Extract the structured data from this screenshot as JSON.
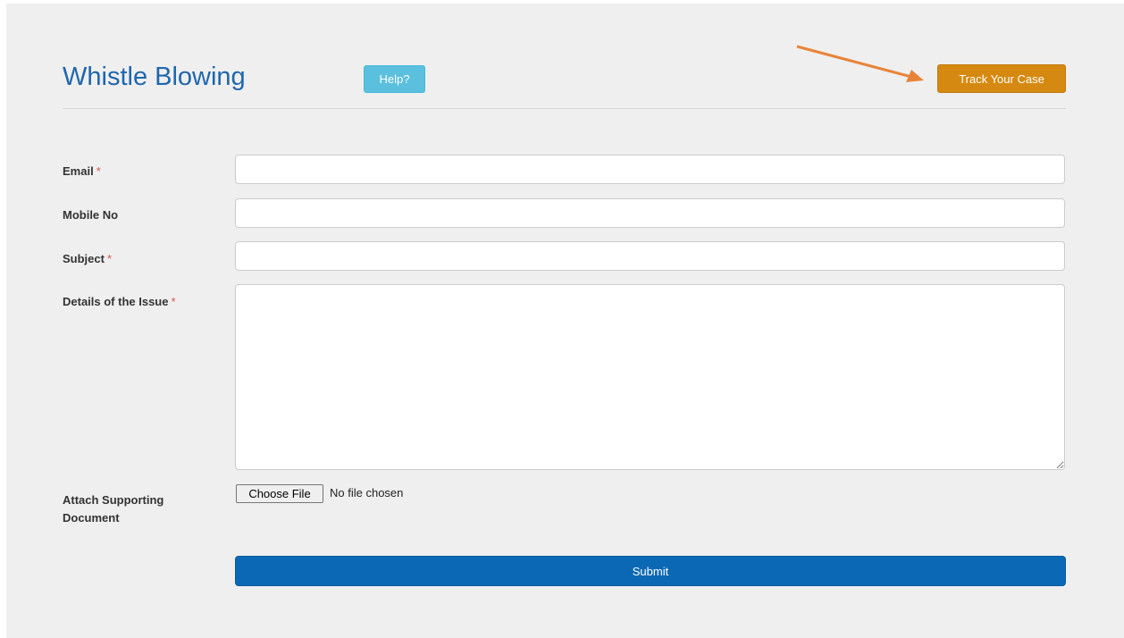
{
  "header": {
    "title": "Whistle Blowing",
    "help_label": "Help?",
    "track_label": "Track Your Case"
  },
  "form": {
    "email": {
      "label": "Email",
      "required": "*",
      "value": ""
    },
    "mobile": {
      "label": "Mobile No",
      "value": ""
    },
    "subject": {
      "label": "Subject",
      "required": "*",
      "value": ""
    },
    "details": {
      "label": "Details of the Issue",
      "required": "*",
      "value": ""
    },
    "attach": {
      "label_line1": "Attach Supporting",
      "label_line2": "Document",
      "button_label": "Choose File",
      "status": "No file chosen"
    },
    "submit_label": "Submit"
  },
  "colors": {
    "title": "#1f66ad",
    "help": "#5bc0de",
    "track": "#d68910",
    "submit": "#0b68b4",
    "arrow": "#e8843a",
    "required": "#d9534f",
    "panel": "#efefef"
  },
  "icons": {
    "annotation": "arrow-pointer-icon"
  }
}
